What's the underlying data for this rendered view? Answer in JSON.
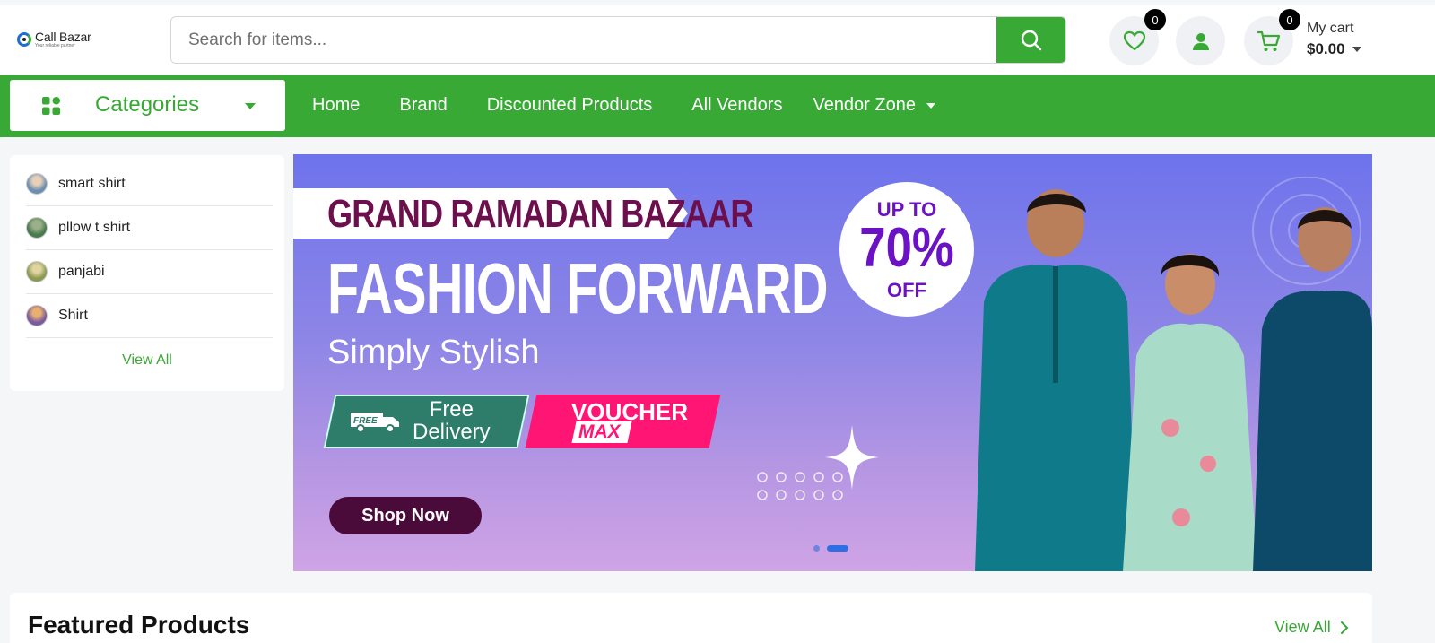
{
  "header": {
    "logo": {
      "name": "Call Bazar",
      "tagline": "Your reliable partner"
    },
    "search": {
      "placeholder": "Search for items..."
    },
    "wishlist_count": "0",
    "cart_count": "0",
    "cart": {
      "label": "My cart",
      "total": "$0.00"
    }
  },
  "nav": {
    "categories_label": "Categories",
    "links": [
      "Home",
      "Brand",
      "Discounted Products",
      "All Vendors",
      "Vendor Zone"
    ]
  },
  "sidebar": {
    "items": [
      "smart shirt",
      "pllow t shirt",
      "panjabi",
      "Shirt"
    ],
    "avatar_colors": [
      "#6b8fb3",
      "#4a7a4f",
      "#8a9a55",
      "#7a5aa0"
    ],
    "view_all": "View All"
  },
  "banner": {
    "headline": "GRAND RAMADAN BAZAAR",
    "title": "FASHION FORWARD",
    "subtitle": "Simply Stylish",
    "offer": {
      "top": "UP TO",
      "value": "70%",
      "bottom": "OFF"
    },
    "free_badge": "FREE",
    "free_delivery": [
      "Free",
      "Delivery"
    ],
    "voucher": "VOUCHER",
    "voucher_tag": "MAX",
    "cta": "Shop Now",
    "slides_total": 2,
    "active_slide": 2
  },
  "featured": {
    "title": "Featured Products",
    "view_all": "View All"
  },
  "colors": {
    "brand_green": "#39a935",
    "black_badge": "#000000",
    "voucher_pink": "#ff1573"
  }
}
